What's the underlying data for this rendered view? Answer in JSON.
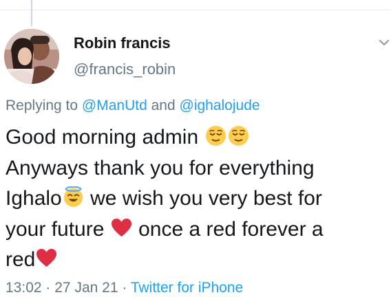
{
  "tweet": {
    "author": {
      "display_name": "Robin francis",
      "handle": "@francis_robin",
      "avatar": "profile-photo"
    },
    "more_icon": "chevron-down-icon",
    "reply": {
      "prefix": "Replying to",
      "mention_1": "@ManUtd",
      "joiner": "and",
      "mention_2": "@ighalojude"
    },
    "body": {
      "line1_text": "Good morning admin",
      "line1_emoji": [
        "relieved-face-icon",
        "relieved-face-icon"
      ],
      "line2_text": "Anyways thank you for everything",
      "line3_text_a": "Ighalo",
      "line3_emoji": "smiling-face-with-halo-icon",
      "line3_text_b": "we wish you very best for",
      "line4_text_a": "your future",
      "line4_emoji": "red-heart-icon",
      "line4_text_b": "once a red forever a",
      "line5_text": "red",
      "line5_emoji": "red-heart-icon"
    },
    "meta": {
      "time": "13:02",
      "separator": "·",
      "date": "27 Jan 21",
      "source": "Twitter for iPhone"
    }
  },
  "colors": {
    "text": "#14171a",
    "muted": "#657786",
    "link": "#1da1f2",
    "heart": "#dd2e44",
    "emoji_face": "#ffcc4d"
  }
}
